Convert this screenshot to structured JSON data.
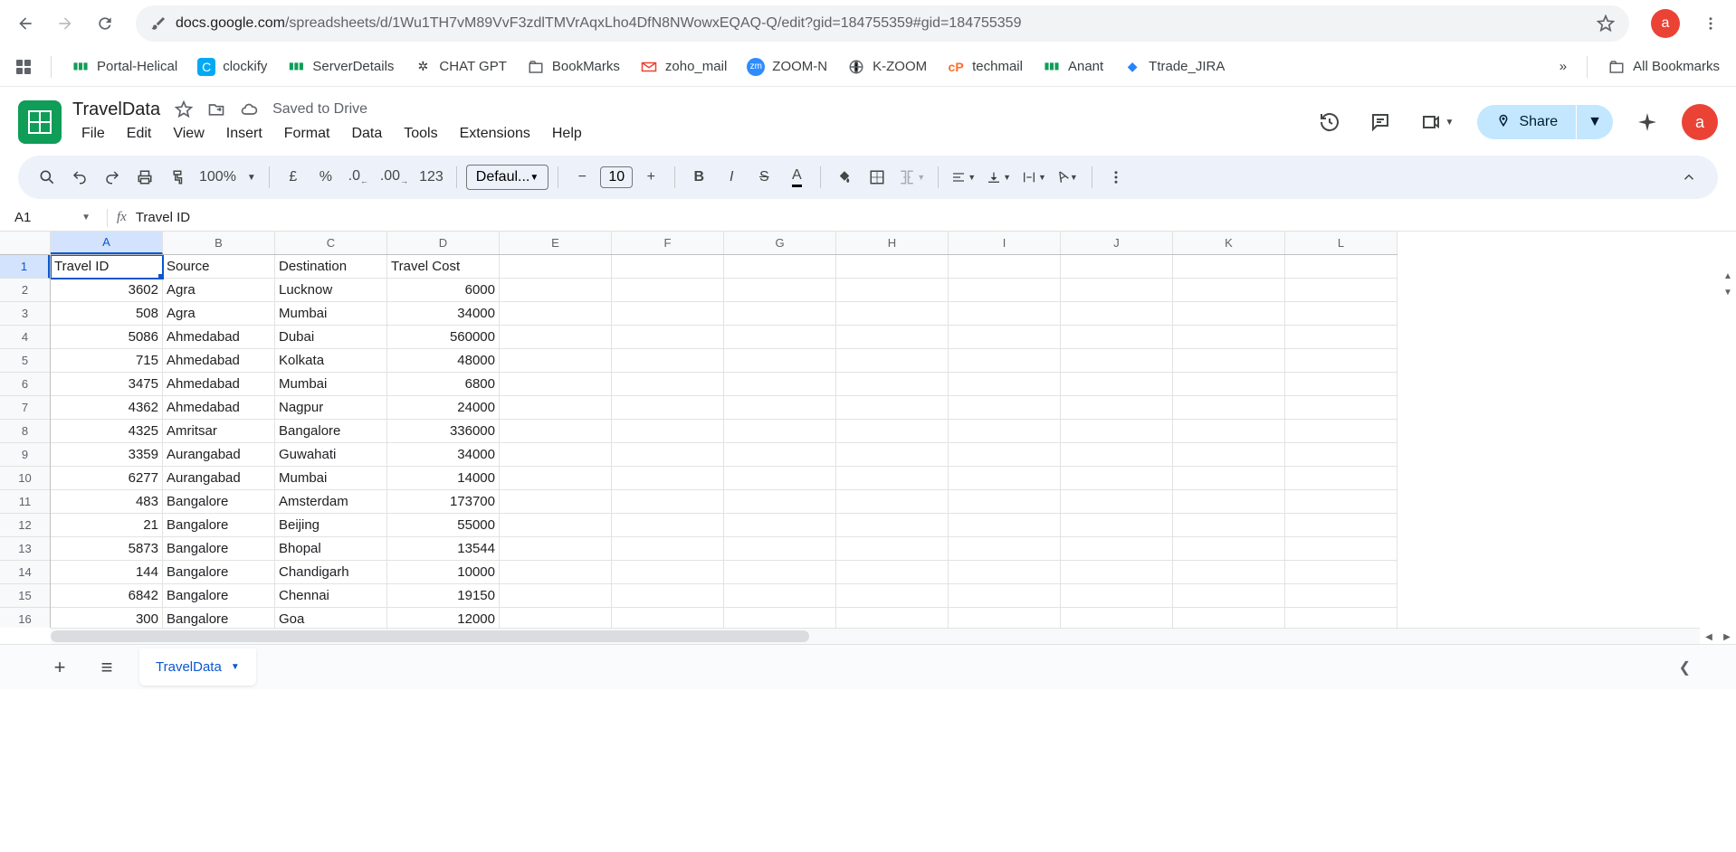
{
  "browser": {
    "url_prefix": "docs.google.com",
    "url_mid": "/spreadsheets/d/",
    "url_id": "1Wu1TH7vM89VvF3zdlTMVrAqxLho4DfN8NWowxEQAQ-Q",
    "url_suffix": "/edit?gid=184755359#gid=184755359",
    "avatar": "a"
  },
  "bookmarks": {
    "items": [
      "Portal-Helical",
      "clockify",
      "ServerDetails",
      "CHAT GPT",
      "BookMarks",
      "zoho_mail",
      "ZOOM-N",
      "K-ZOOM",
      "techmail",
      "Anant",
      "Ttrade_JIRA"
    ],
    "all": "All Bookmarks"
  },
  "doc": {
    "title": "TravelData",
    "saved": "Saved to Drive",
    "menus": [
      "File",
      "Edit",
      "View",
      "Insert",
      "Format",
      "Data",
      "Tools",
      "Extensions",
      "Help"
    ],
    "share": "Share",
    "avatar": "a"
  },
  "toolbar": {
    "zoom": "100%",
    "currency": "£",
    "percent": "%",
    "dec_dec": ".0",
    "inc_dec": ".00",
    "num_fmt": "123",
    "font": "Defaul...",
    "size": "10"
  },
  "formula": {
    "cell": "A1",
    "fx": "fx",
    "value": "Travel ID"
  },
  "grid": {
    "cols": [
      "A",
      "B",
      "C",
      "D",
      "E",
      "F",
      "G",
      "H",
      "I",
      "J",
      "K",
      "L"
    ],
    "rows": [
      {
        "n": "1",
        "cells": [
          {
            "v": "Travel ID",
            "t": "text",
            "sel": true
          },
          {
            "v": "Source",
            "t": "text"
          },
          {
            "v": "Destination",
            "t": "text"
          },
          {
            "v": "Travel Cost",
            "t": "text"
          }
        ]
      },
      {
        "n": "2",
        "cells": [
          {
            "v": "3602",
            "t": "num"
          },
          {
            "v": "Agra",
            "t": "text"
          },
          {
            "v": "Lucknow",
            "t": "text"
          },
          {
            "v": "6000",
            "t": "num"
          }
        ]
      },
      {
        "n": "3",
        "cells": [
          {
            "v": "508",
            "t": "num"
          },
          {
            "v": "Agra",
            "t": "text"
          },
          {
            "v": "Mumbai",
            "t": "text"
          },
          {
            "v": "34000",
            "t": "num"
          }
        ]
      },
      {
        "n": "4",
        "cells": [
          {
            "v": "5086",
            "t": "num"
          },
          {
            "v": "Ahmedabad",
            "t": "text"
          },
          {
            "v": "Dubai",
            "t": "text"
          },
          {
            "v": "560000",
            "t": "num"
          }
        ]
      },
      {
        "n": "5",
        "cells": [
          {
            "v": "715",
            "t": "num"
          },
          {
            "v": "Ahmedabad",
            "t": "text"
          },
          {
            "v": "Kolkata",
            "t": "text"
          },
          {
            "v": "48000",
            "t": "num"
          }
        ]
      },
      {
        "n": "6",
        "cells": [
          {
            "v": "3475",
            "t": "num"
          },
          {
            "v": "Ahmedabad",
            "t": "text"
          },
          {
            "v": "Mumbai",
            "t": "text"
          },
          {
            "v": "6800",
            "t": "num"
          }
        ]
      },
      {
        "n": "7",
        "cells": [
          {
            "v": "4362",
            "t": "num"
          },
          {
            "v": "Ahmedabad",
            "t": "text"
          },
          {
            "v": "Nagpur",
            "t": "text"
          },
          {
            "v": "24000",
            "t": "num"
          }
        ]
      },
      {
        "n": "8",
        "cells": [
          {
            "v": "4325",
            "t": "num"
          },
          {
            "v": "Amritsar",
            "t": "text"
          },
          {
            "v": "Bangalore",
            "t": "text"
          },
          {
            "v": "336000",
            "t": "num"
          }
        ]
      },
      {
        "n": "9",
        "cells": [
          {
            "v": "3359",
            "t": "num"
          },
          {
            "v": "Aurangabad",
            "t": "text"
          },
          {
            "v": "Guwahati",
            "t": "text"
          },
          {
            "v": "34000",
            "t": "num"
          }
        ]
      },
      {
        "n": "10",
        "cells": [
          {
            "v": "6277",
            "t": "num"
          },
          {
            "v": "Aurangabad",
            "t": "text"
          },
          {
            "v": "Mumbai",
            "t": "text"
          },
          {
            "v": "14000",
            "t": "num"
          }
        ]
      },
      {
        "n": "11",
        "cells": [
          {
            "v": "483",
            "t": "num"
          },
          {
            "v": "Bangalore",
            "t": "text"
          },
          {
            "v": "Amsterdam",
            "t": "text"
          },
          {
            "v": "173700",
            "t": "num"
          }
        ]
      },
      {
        "n": "12",
        "cells": [
          {
            "v": "21",
            "t": "num"
          },
          {
            "v": "Bangalore",
            "t": "text"
          },
          {
            "v": "Beijing",
            "t": "text"
          },
          {
            "v": "55000",
            "t": "num"
          }
        ]
      },
      {
        "n": "13",
        "cells": [
          {
            "v": "5873",
            "t": "num"
          },
          {
            "v": "Bangalore",
            "t": "text"
          },
          {
            "v": "Bhopal",
            "t": "text"
          },
          {
            "v": "13544",
            "t": "num"
          }
        ]
      },
      {
        "n": "14",
        "cells": [
          {
            "v": "144",
            "t": "num"
          },
          {
            "v": "Bangalore",
            "t": "text"
          },
          {
            "v": "Chandigarh",
            "t": "text"
          },
          {
            "v": "10000",
            "t": "num"
          }
        ]
      },
      {
        "n": "15",
        "cells": [
          {
            "v": "6842",
            "t": "num"
          },
          {
            "v": "Bangalore",
            "t": "text"
          },
          {
            "v": "Chennai",
            "t": "text"
          },
          {
            "v": "19150",
            "t": "num"
          }
        ]
      },
      {
        "n": "16",
        "cells": [
          {
            "v": "300",
            "t": "num"
          },
          {
            "v": "Bangalore",
            "t": "text"
          },
          {
            "v": "Goa",
            "t": "text"
          },
          {
            "v": "12000",
            "t": "num"
          }
        ]
      }
    ]
  },
  "tabs": {
    "active": "TravelData"
  }
}
